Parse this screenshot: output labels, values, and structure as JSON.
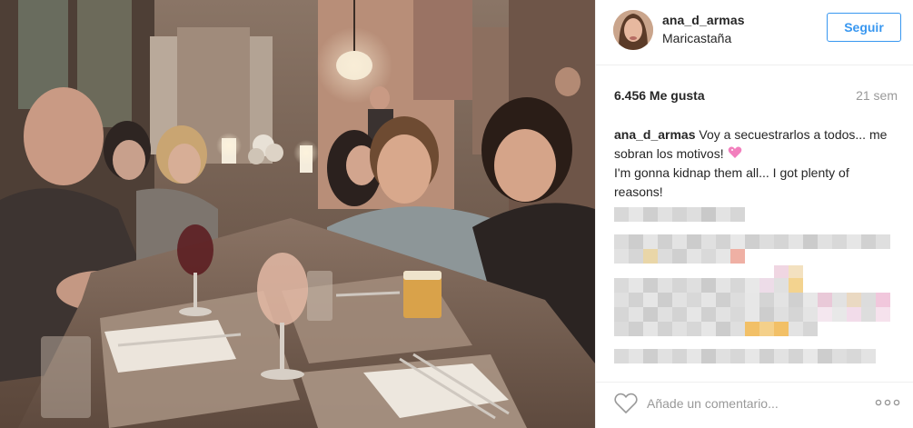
{
  "post": {
    "photo_alt": "",
    "username": "ana_d_armas",
    "location": "Maricastaña",
    "follow_label": "Seguir",
    "likes": "6.456 Me gusta",
    "time": "21 sem",
    "caption": {
      "user": "ana_d_armas",
      "line1": "Voy a secuestrarlos a todos... me sobran los motivos!",
      "line2": "I'm gonna kidnap them all... I got plenty of reasons!"
    },
    "comment_placeholder": "Añade un comentario..."
  },
  "icons": {
    "like": "heart-outline-icon",
    "more": "more-options-icon",
    "emoji": "sparkling-heart-icon"
  },
  "colors": {
    "follow_blue": "#3897f0",
    "text": "#262626",
    "muted": "#999999",
    "emoji_pink": "#f27fbd"
  }
}
